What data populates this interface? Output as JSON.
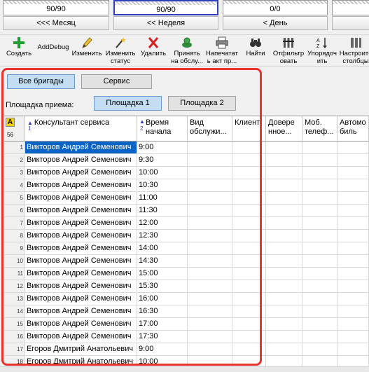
{
  "top_strip": {
    "values": [
      "90/90",
      "90/90",
      "0/0",
      ""
    ]
  },
  "nav": {
    "month_label": "<<< Месяц",
    "week_label": "<< Неделя",
    "day_label": "< День"
  },
  "toolbar": {
    "items": [
      {
        "label": "Создать",
        "icon": "plus-icon"
      },
      {
        "label": "AddDebug",
        "icon": ""
      },
      {
        "label": "Изменить",
        "icon": "pencil-icon"
      },
      {
        "label": "Изменить\nстатус",
        "icon": "wand-icon"
      },
      {
        "label": "Удалить",
        "icon": "delete-x-icon"
      },
      {
        "label": "Принять\nна обслу...",
        "icon": "accept-icon"
      },
      {
        "label": "Напечатат\nь акт пр...",
        "icon": "printer-icon"
      },
      {
        "label": "Найти",
        "icon": "binoculars-icon"
      },
      {
        "label": "Отфильтр\nовать",
        "icon": "filter-icon"
      },
      {
        "label": "Упорядоч\nить",
        "icon": "sort-icon"
      },
      {
        "label": "Настроить\nстолбцы",
        "icon": "columns-icon"
      }
    ]
  },
  "tabs": {
    "all_brigades": "Все бригады",
    "service": "Сервис"
  },
  "platform": {
    "label": "Площадка приема:",
    "p1": "Площадка 1",
    "p2": "Площадка 2"
  },
  "grid": {
    "corner_letter": "A",
    "corner_count": "56",
    "columns": [
      {
        "label": "Консультант сервиса",
        "sort": "1"
      },
      {
        "label": "Время\nначала",
        "sort": "2"
      },
      {
        "label": "Вид\nобслужи...",
        "sort": ""
      },
      {
        "label": "Клиент",
        "sort": ""
      },
      {
        "label": "Довере\nнное...",
        "sort": ""
      },
      {
        "label": "Моб.\nтелеф...",
        "sort": ""
      },
      {
        "label": "Автомо\nбиль",
        "sort": ""
      }
    ],
    "rows": [
      {
        "n": "1",
        "consultant": "Викторов Андрей Семенович",
        "time": "9:00"
      },
      {
        "n": "2",
        "consultant": "Викторов Андрей Семенович",
        "time": "9:30"
      },
      {
        "n": "3",
        "consultant": "Викторов Андрей Семенович",
        "time": "10:00"
      },
      {
        "n": "4",
        "consultant": "Викторов Андрей Семенович",
        "time": "10:30"
      },
      {
        "n": "5",
        "consultant": "Викторов Андрей Семенович",
        "time": "11:00"
      },
      {
        "n": "6",
        "consultant": "Викторов Андрей Семенович",
        "time": "11:30"
      },
      {
        "n": "7",
        "consultant": "Викторов Андрей Семенович",
        "time": "12:00"
      },
      {
        "n": "8",
        "consultant": "Викторов Андрей Семенович",
        "time": "12:30"
      },
      {
        "n": "9",
        "consultant": "Викторов Андрей Семенович",
        "time": "14:00"
      },
      {
        "n": "10",
        "consultant": "Викторов Андрей Семенович",
        "time": "14:30"
      },
      {
        "n": "11",
        "consultant": "Викторов Андрей Семенович",
        "time": "15:00"
      },
      {
        "n": "12",
        "consultant": "Викторов Андрей Семенович",
        "time": "15:30"
      },
      {
        "n": "13",
        "consultant": "Викторов Андрей Семенович",
        "time": "16:00"
      },
      {
        "n": "14",
        "consultant": "Викторов Андрей Семенович",
        "time": "16:30"
      },
      {
        "n": "15",
        "consultant": "Викторов Андрей Семенович",
        "time": "17:00"
      },
      {
        "n": "16",
        "consultant": "Викторов Андрей Семенович",
        "time": "17:30"
      },
      {
        "n": "17",
        "consultant": "Егоров Дмитрий Анатольевич",
        "time": "9:00"
      },
      {
        "n": "18",
        "consultant": "Егоров Дмитрий Анатольевич",
        "time": "10:00"
      }
    ]
  },
  "colors": {
    "selection": "#0a64c8",
    "highlight": "#e8332e",
    "active_tab": "#c4ddf3"
  }
}
